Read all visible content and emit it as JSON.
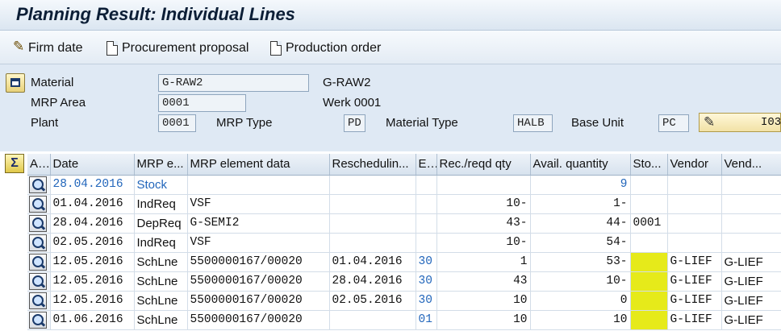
{
  "title": "Planning Result: Individual Lines",
  "toolbar": {
    "firm_date": "Firm date",
    "procurement_proposal": "Procurement proposal",
    "production_order": "Production order"
  },
  "header": {
    "material_label": "Material",
    "material_value": "G-RAW2",
    "material_desc": "G-RAW2",
    "mrp_area_label": "MRP Area",
    "mrp_area_value": "0001",
    "mrp_area_desc": "Werk 0001",
    "plant_label": "Plant",
    "plant_value": "0001",
    "mrp_type_label": "MRP Type",
    "mrp_type_value": "PD",
    "material_type_label": "Material Type",
    "material_type_value": "HALB",
    "base_unit_label": "Base Unit",
    "base_unit_value": "PC",
    "status_value": "I03"
  },
  "grid": {
    "columns": [
      "A...",
      "Date",
      "MRP e...",
      "MRP element data",
      "Reschedulin...",
      "E...",
      "Rec./reqd qty",
      "Avail. quantity",
      "Sto...",
      "Vendor",
      "Vend..."
    ],
    "rows": [
      {
        "date": "28.04.2016",
        "mrp": "Stock",
        "data": "",
        "resched": "",
        "e": "",
        "rec": "",
        "avail": "9",
        "sto": "",
        "vendor": "",
        "vend": "",
        "blue": true
      },
      {
        "date": "01.04.2016",
        "mrp": "IndReq",
        "data": "VSF",
        "resched": "",
        "e": "",
        "rec": "10-",
        "avail": "1-",
        "sto": "",
        "vendor": "",
        "vend": ""
      },
      {
        "date": "28.04.2016",
        "mrp": "DepReq",
        "data": "G-SEMI2",
        "resched": "",
        "e": "",
        "rec": "43-",
        "avail": "44-",
        "sto": "0001",
        "vendor": "",
        "vend": ""
      },
      {
        "date": "02.05.2016",
        "mrp": "IndReq",
        "data": "VSF",
        "resched": "",
        "e": "",
        "rec": "10-",
        "avail": "54-",
        "sto": "",
        "vendor": "",
        "vend": ""
      },
      {
        "date": "12.05.2016",
        "mrp": "SchLne",
        "data": "5500000167/00020",
        "resched": "01.04.2016",
        "e": "30",
        "rec": "1",
        "avail": "53-",
        "sto": "",
        "vendor": "G-LIEF",
        "vend": "G-LIEF",
        "hl": true
      },
      {
        "date": "12.05.2016",
        "mrp": "SchLne",
        "data": "5500000167/00020",
        "resched": "28.04.2016",
        "e": "30",
        "rec": "43",
        "avail": "10-",
        "sto": "",
        "vendor": "G-LIEF",
        "vend": "G-LIEF",
        "hl": true
      },
      {
        "date": "12.05.2016",
        "mrp": "SchLne",
        "data": "5500000167/00020",
        "resched": "02.05.2016",
        "e": "30",
        "rec": "10",
        "avail": "0",
        "sto": "",
        "vendor": "G-LIEF",
        "vend": "G-LIEF",
        "hl": true
      },
      {
        "date": "01.06.2016",
        "mrp": "SchLne",
        "data": "5500000167/00020",
        "resched": "",
        "e": "01",
        "rec": "10",
        "avail": "10",
        "sto": "",
        "vendor": "G-LIEF",
        "vend": "G-LIEF",
        "hl": true
      }
    ]
  }
}
